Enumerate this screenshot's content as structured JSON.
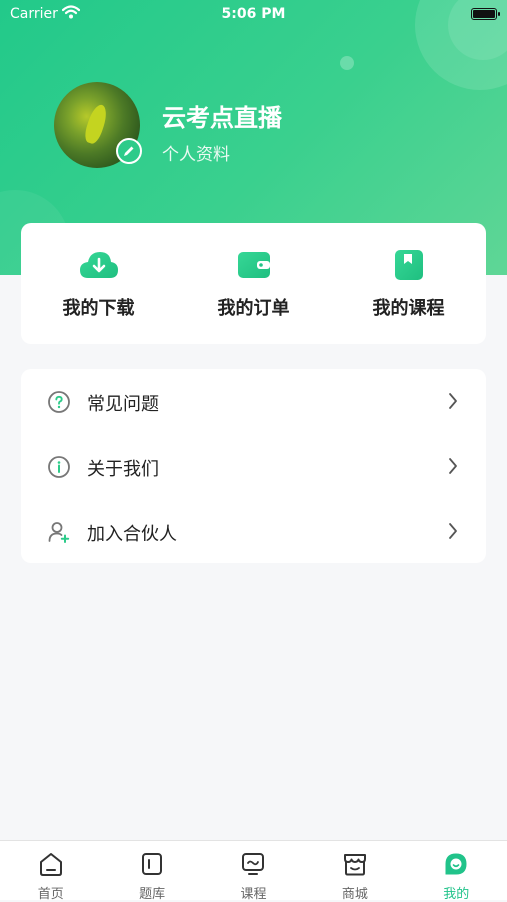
{
  "status_bar": {
    "carrier": "Carrier",
    "time": "5:06 PM"
  },
  "profile": {
    "nickname": "云考点直播",
    "subtitle": "个人资料"
  },
  "quick_actions": [
    {
      "label": "我的下载",
      "icon": "download-cloud-icon"
    },
    {
      "label": "我的订单",
      "icon": "wallet-icon"
    },
    {
      "label": "我的课程",
      "icon": "book-bookmark-icon"
    }
  ],
  "menu": [
    {
      "label": "常见问题",
      "icon": "question-circle-icon"
    },
    {
      "label": "关于我们",
      "icon": "info-circle-icon"
    },
    {
      "label": "加入合伙人",
      "icon": "add-user-icon"
    }
  ],
  "tabs": [
    {
      "label": "首页",
      "icon": "home-icon"
    },
    {
      "label": "题库",
      "icon": "question-bank-icon"
    },
    {
      "label": "课程",
      "icon": "course-monitor-icon"
    },
    {
      "label": "商城",
      "icon": "store-icon"
    },
    {
      "label": "我的",
      "icon": "profile-leaf-icon",
      "active": true
    }
  ],
  "colors": {
    "accent": "#21c38a",
    "header_start": "#22c98a",
    "header_end": "#5fd696",
    "background": "#f6f7f9"
  }
}
